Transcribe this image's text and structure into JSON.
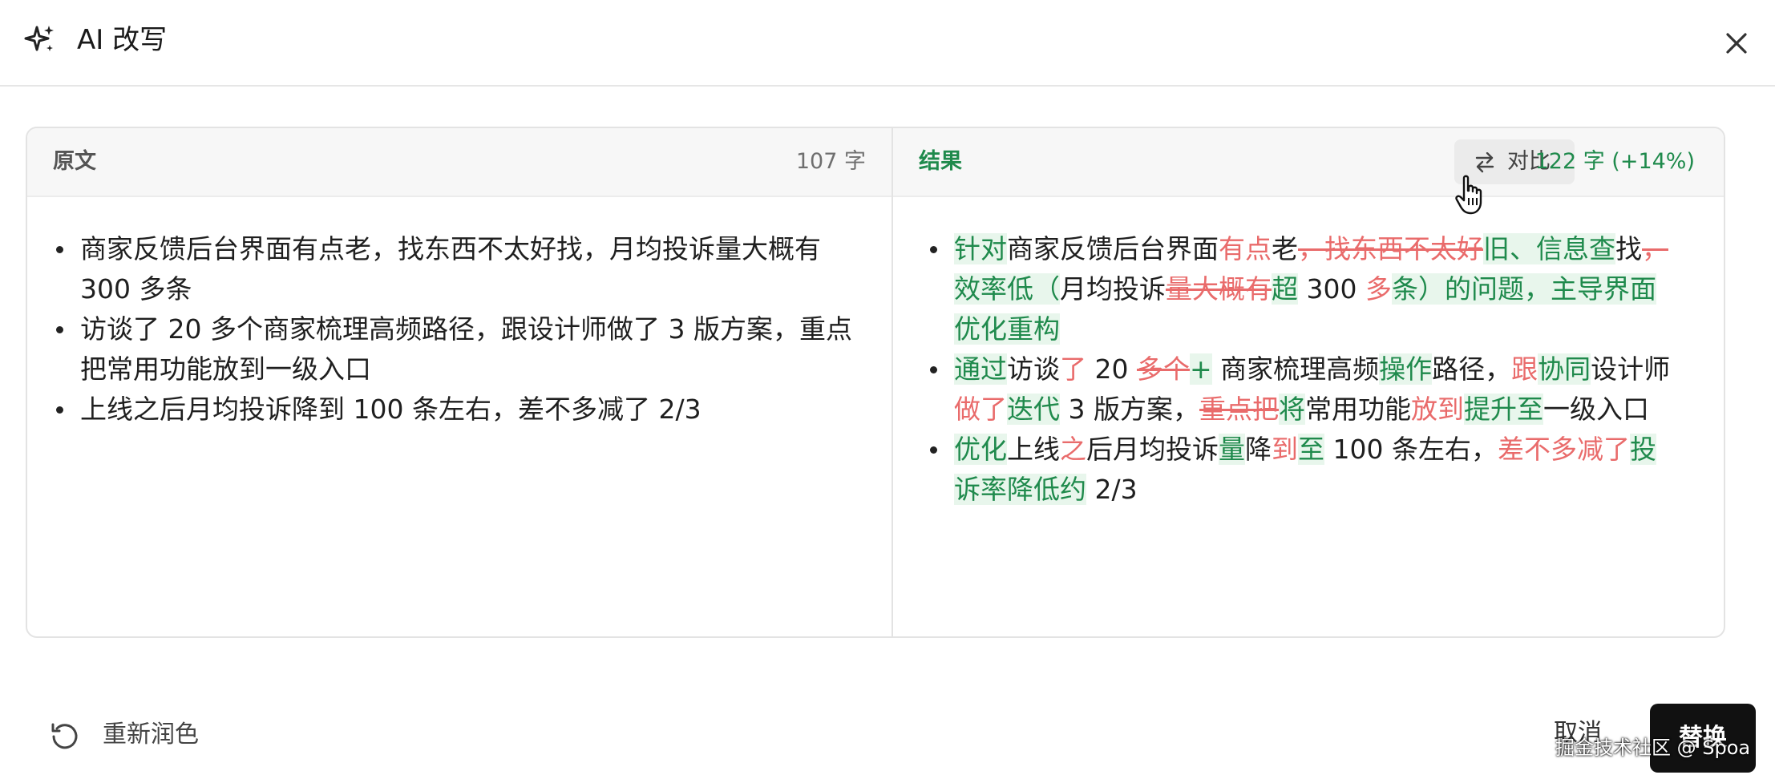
{
  "header": {
    "title": "AI 改写",
    "icon": "sparkle-icon",
    "close_icon": "close-icon"
  },
  "original": {
    "label": "原文",
    "count": "107 字",
    "items": [
      "商家反馈后台界面有点老，找东西不太好找，月均投诉量大概有 300 多条",
      "访谈了 20 多个商家梳理高频路径，跟设计师做了 3 版方案，重点把常用功能放到一级入口",
      "上线之后月均投诉降到 100 条左右，差不多减了 2/3"
    ]
  },
  "result": {
    "label": "结果",
    "compare_label": "对比",
    "count": "122 字 (+14%)",
    "items": [
      [
        {
          "t": "针对",
          "k": "ins"
        },
        {
          "t": "商家反馈后台界面",
          "k": "same"
        },
        {
          "t": "有点",
          "k": "rem"
        },
        {
          "t": "老",
          "k": "same"
        },
        {
          "t": "，找东西不太好",
          "k": "del"
        },
        {
          "t": "旧、信息查",
          "k": "ins"
        },
        {
          "t": "找",
          "k": "same"
        },
        {
          "t": "，",
          "k": "del"
        },
        {
          "t": "效率低（",
          "k": "ins"
        },
        {
          "t": "月均投诉",
          "k": "same"
        },
        {
          "t": "量大概有",
          "k": "del"
        },
        {
          "t": "超",
          "k": "ins"
        },
        {
          "t": " 300 ",
          "k": "same"
        },
        {
          "t": "多",
          "k": "rem"
        },
        {
          "t": "条）的问题，主导界面优化重构",
          "k": "ins"
        }
      ],
      [
        {
          "t": "通过",
          "k": "ins"
        },
        {
          "t": "访谈",
          "k": "same"
        },
        {
          "t": "了",
          "k": "rem"
        },
        {
          "t": " 20 ",
          "k": "same"
        },
        {
          "t": "多个",
          "k": "del"
        },
        {
          "t": "+",
          "k": "ins"
        },
        {
          "t": " 商家梳理高频",
          "k": "same"
        },
        {
          "t": "操作",
          "k": "ins"
        },
        {
          "t": "路径，",
          "k": "same"
        },
        {
          "t": "跟",
          "k": "rem"
        },
        {
          "t": "协同",
          "k": "ins"
        },
        {
          "t": "设计师",
          "k": "same"
        },
        {
          "t": "做了",
          "k": "rem"
        },
        {
          "t": "迭代",
          "k": "ins"
        },
        {
          "t": " 3 版方案，",
          "k": "same"
        },
        {
          "t": "重点把",
          "k": "del"
        },
        {
          "t": "将",
          "k": "ins"
        },
        {
          "t": "常用功能",
          "k": "same"
        },
        {
          "t": "放到",
          "k": "rem"
        },
        {
          "t": "提升至",
          "k": "ins"
        },
        {
          "t": "一级入口",
          "k": "same"
        }
      ],
      [
        {
          "t": "优化",
          "k": "ins"
        },
        {
          "t": "上线",
          "k": "same"
        },
        {
          "t": "之",
          "k": "rem"
        },
        {
          "t": "后月均投诉",
          "k": "same"
        },
        {
          "t": "量",
          "k": "ins"
        },
        {
          "t": "降",
          "k": "same"
        },
        {
          "t": "到",
          "k": "rem"
        },
        {
          "t": "至",
          "k": "ins"
        },
        {
          "t": " 100 条左右，",
          "k": "same"
        },
        {
          "t": "差不多减了",
          "k": "rem"
        },
        {
          "t": "投诉率降低约",
          "k": "ins"
        },
        {
          "t": " 2/3",
          "k": "same"
        }
      ]
    ]
  },
  "footer": {
    "regenerate_label": "重新润色",
    "cancel_label": "取消",
    "replace_label": "替换"
  },
  "watermark": "掘金技术社区 @ Spoa",
  "colors": {
    "accent_green": "#1f8a4c",
    "diff_red": "#e96b6b",
    "insert_bg": "#e8f6ec",
    "primary_button": "#111111"
  }
}
